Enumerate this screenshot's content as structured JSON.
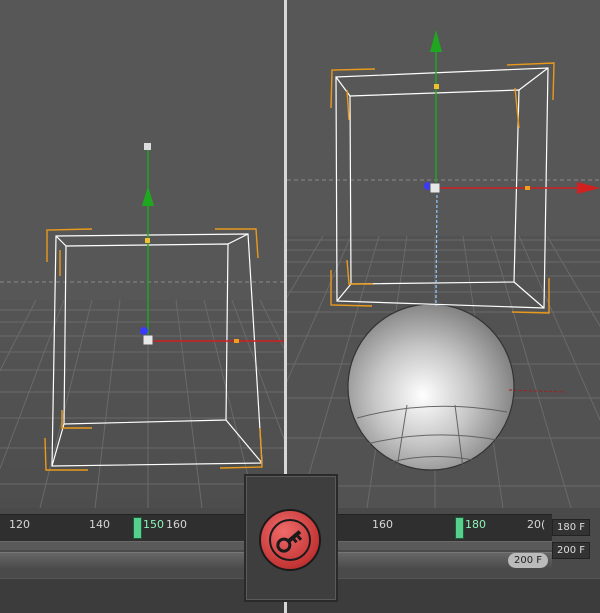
{
  "app": {
    "name": "3D viewport with animation timeline"
  },
  "left_timeline": {
    "ticks": [
      "120",
      "140",
      "150",
      "160"
    ],
    "current_frame": "150"
  },
  "right_timeline": {
    "ticks": [
      "160",
      "180",
      "20("
    ],
    "current_frame": "180",
    "end_field": "180 F",
    "range_pill": "200 F",
    "range_field": "200 F"
  },
  "icons": {
    "record": "record-key-icon"
  },
  "colors": {
    "viewport_bg": "#555555",
    "axis_x": "#d02020",
    "axis_y": "#1fa81f",
    "axis_z": "#3a3aff",
    "bbox_corner": "#e89a1c",
    "scrubber": "#57d08d",
    "record_button": "#d14444"
  }
}
